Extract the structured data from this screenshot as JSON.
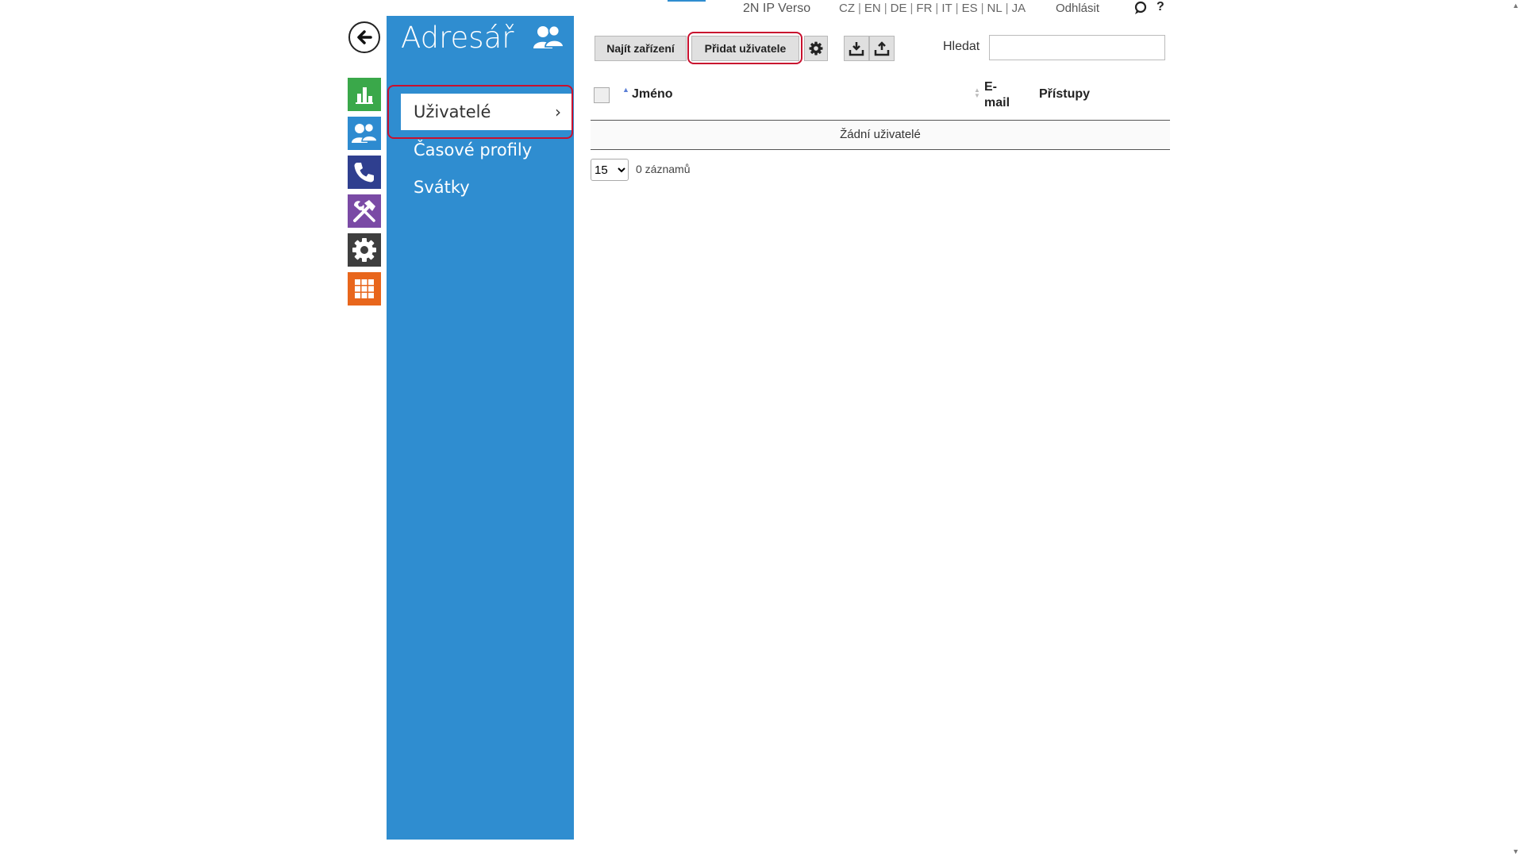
{
  "topbar": {
    "device_name": "2N IP Verso",
    "languages": [
      "CZ",
      "EN",
      "DE",
      "FR",
      "IT",
      "ES",
      "NL",
      "JA"
    ],
    "logout_label": "Odhlásit",
    "help_label": "?",
    "chat_icon": "chat-bubble-icon"
  },
  "rail": {
    "back_icon": "arrow-left-icon",
    "tiles": [
      {
        "name": "status",
        "icon": "bar-chart-icon",
        "color": "#3aa84a"
      },
      {
        "name": "directory",
        "icon": "users-icon",
        "color": "#2e8bd0"
      },
      {
        "name": "services",
        "icon": "phone-icon",
        "color": "#2f3f8f"
      },
      {
        "name": "hardware",
        "icon": "tools-icon",
        "color": "#7a4aa5"
      },
      {
        "name": "system",
        "icon": "gear-icon",
        "color": "#3e3e3e"
      },
      {
        "name": "apps",
        "icon": "grid-icon",
        "color": "#e8661c"
      }
    ]
  },
  "nav": {
    "title": "Adresář",
    "items": [
      {
        "label": "Uživatelé",
        "active": true
      },
      {
        "label": "Časové profily",
        "active": false
      },
      {
        "label": "Svátky",
        "active": false
      }
    ],
    "accent_color": "#2f8dd0"
  },
  "toolbar": {
    "find_devices_label": "Najít zařízení",
    "add_user_label": "Přidat uživatele",
    "search_label": "Hledat",
    "search_value": ""
  },
  "table": {
    "columns": [
      "Jméno",
      "E-mail",
      "Přístupy"
    ],
    "empty_text": "Žádní uživatelé",
    "page_size": "15",
    "page_size_options": [
      "15"
    ],
    "records_text": "0 záznamů"
  },
  "highlight_color": "#c8102e"
}
